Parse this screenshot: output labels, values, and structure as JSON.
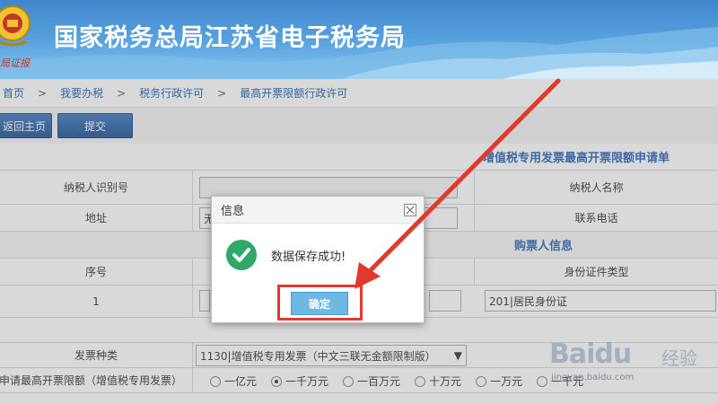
{
  "header": {
    "site_title": "国家税务总局江苏省电子税务局",
    "seal_text": "局证报"
  },
  "breadcrumb": {
    "items": [
      "首页",
      "我要办税",
      "税务行政许可",
      "最高开票限额行政许可"
    ],
    "separator": ">"
  },
  "toolbar": {
    "home_label": "返回主页",
    "submit_label": "提交"
  },
  "form": {
    "title": "增值税专用发票最高开票限额申请单",
    "taxpayer_id_label": "纳税人识别号",
    "taxpayer_name_label": "纳税人名称",
    "address_label": "地址",
    "address_value": "无",
    "phone_label": "联系电话",
    "buyer_section_title": "购票人信息",
    "seq_label": "序号",
    "id_type_label": "身份证件类型",
    "seq_value": "1",
    "id_type_value": "201|居民身份证",
    "invoice_type_label": "发票种类",
    "invoice_type_value": "1130|增值税专用发票（中文三联无金额限制版）",
    "limit_label": "申请最高开票限额（增值税专用发票）",
    "limit_options": [
      "一亿元",
      "一千万元",
      "一百万元",
      "十万元",
      "一万元",
      "一千元"
    ],
    "limit_selected_index": 1
  },
  "dialog": {
    "title": "信息",
    "message": "数据保存成功!",
    "ok_label": "确定",
    "icon": "checkmark-icon"
  },
  "watermark": {
    "brand": "Baidu",
    "cn": "经验",
    "url": "jingyan.baidu.com"
  },
  "colors": {
    "banner": "#3f86cc",
    "link": "#1b5fae",
    "button": "#2a5ea6",
    "success": "#2fa86a",
    "ok_button": "#6fb8e6",
    "annotation": "#e03a2e"
  }
}
